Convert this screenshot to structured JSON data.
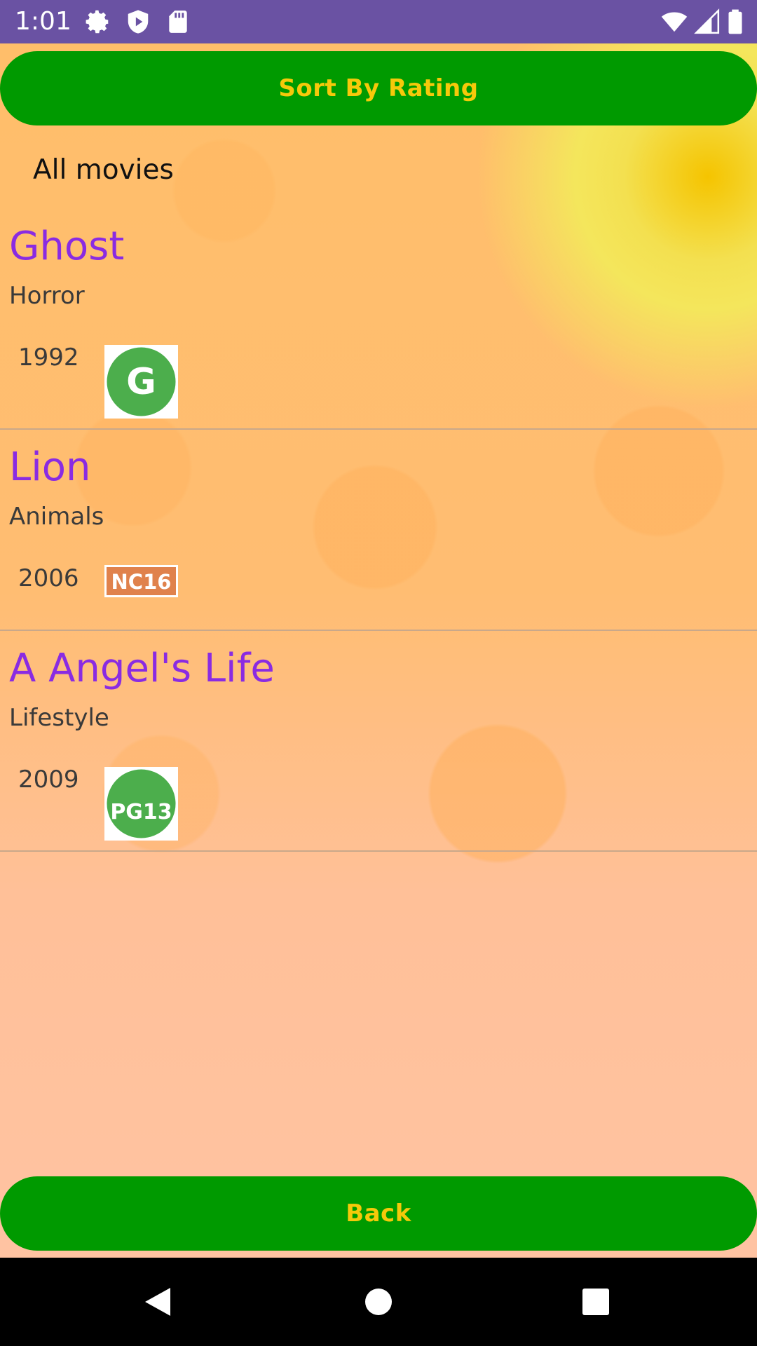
{
  "status_bar": {
    "time": "1:01",
    "icons_left": [
      "gear-icon",
      "shield-icon",
      "sd-card-icon"
    ],
    "icons_right": [
      "wifi-icon",
      "signal-icon",
      "battery-icon"
    ]
  },
  "actions": {
    "sort_label": "Sort By Rating",
    "back_label": "Back"
  },
  "list": {
    "header": "All movies",
    "movies": [
      {
        "title": "Ghost",
        "genre": "Horror",
        "year": "1992",
        "rating_badge": "G"
      },
      {
        "title": "Lion",
        "genre": "Animals",
        "year": "2006",
        "rating_badge": "NC16"
      },
      {
        "title": "A Angel's Life",
        "genre": "Lifestyle",
        "year": "2009",
        "rating_badge": "PG13"
      }
    ]
  },
  "nav_bar": {
    "buttons": [
      "back-triangle-icon",
      "home-circle-icon",
      "recents-square-icon"
    ]
  },
  "colors": {
    "status_bar": "#6a52a3",
    "button_bg": "#009a00",
    "button_text": "#f6c90a",
    "title_text": "#8a2be2"
  }
}
